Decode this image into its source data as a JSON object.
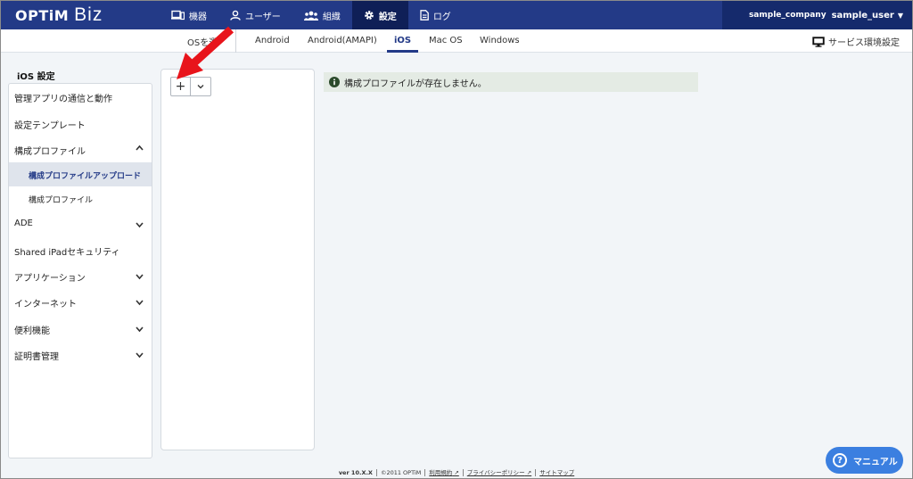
{
  "header": {
    "brand": "OPTiM",
    "product": "Biz",
    "nav": [
      {
        "label": "機器",
        "icon": "devices-icon"
      },
      {
        "label": "ユーザー",
        "icon": "user-icon"
      },
      {
        "label": "組織",
        "icon": "organization-icon"
      },
      {
        "label": "設定",
        "icon": "gear-icon"
      },
      {
        "label": "ログ",
        "icon": "log-icon"
      }
    ],
    "active_nav": "設定",
    "company": "sample_company",
    "user": "sample_user"
  },
  "tabs": {
    "os_select": "OSを選",
    "items": [
      "Android",
      "Android(AMAPI)",
      "iOS",
      "Mac OS",
      "Windows"
    ],
    "active": "iOS",
    "service_settings": "サービス環境設定"
  },
  "sidebar": {
    "title": "iOS 設定",
    "items": [
      {
        "label": "管理アプリの通信と動作"
      },
      {
        "label": "設定テンプレート"
      },
      {
        "label": "構成プロファイル",
        "expanded": true
      },
      {
        "label": "構成プロファイルアップロード",
        "sub": true,
        "active": true
      },
      {
        "label": "構成プロファイル",
        "sub": true
      },
      {
        "label": "ADE"
      },
      {
        "label": "Shared iPadセキュリティ"
      },
      {
        "label": "アプリケーション"
      },
      {
        "label": "インターネット"
      },
      {
        "label": "便利機能"
      },
      {
        "label": "証明書管理"
      }
    ]
  },
  "panel": {
    "add_label": "+"
  },
  "message": {
    "text": "構成プロファイルが存在しません。"
  },
  "footer": {
    "version": "ver 10.X.X",
    "copyright": "©2011 OPTiM",
    "terms": "利用規約",
    "privacy": "プライバシーポリシー",
    "sitemap": "サイトマップ"
  },
  "manual": {
    "label": "マニュアル"
  },
  "colors": {
    "header_bg": "#233a87",
    "accent": "#233a87",
    "manual_bg": "#3b7fe0",
    "arrow": "#e8141b"
  }
}
